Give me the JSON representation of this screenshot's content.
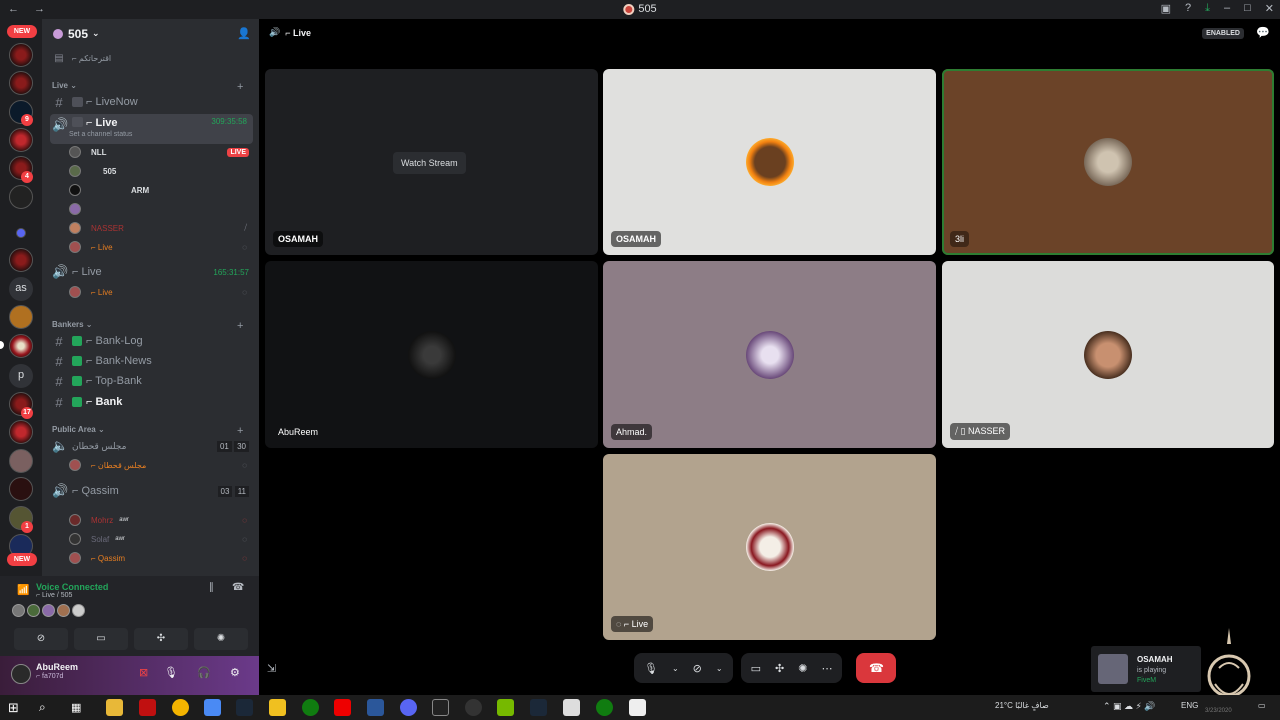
{
  "window": {
    "title": "505",
    "nav": "← →"
  },
  "server_rail": {
    "new_label": "NEW",
    "text_servers": [
      "as",
      "p"
    ],
    "badges": [
      "9",
      "4",
      "17",
      "1"
    ]
  },
  "guild": {
    "name": "505",
    "top_channel": "⌐ اقترحاتكم",
    "categories": [
      {
        "name": "Live"
      },
      {
        "name": "Bankers"
      },
      {
        "name": "Public Area"
      }
    ],
    "live_channels": {
      "livenow": "⌐ LiveNow",
      "live1": {
        "name": "⌐ Live",
        "status": "Set a channel status",
        "timer": "309:35:58"
      },
      "live2": {
        "name": "⌐ Live",
        "timer": "165:31:57"
      }
    },
    "live1_users": [
      {
        "name": "",
        "tag": "NLL",
        "live": "LIVE"
      },
      {
        "name": "",
        "tag": "505"
      },
      {
        "name": "",
        "tag": "ARM"
      },
      {
        "name": "",
        "tag": ""
      },
      {
        "name": "NASSER",
        "tag": ""
      },
      {
        "name": "",
        "tag": "⌐ Live"
      }
    ],
    "live2_users": [
      {
        "name": "⌐ Live"
      }
    ],
    "bank_channels": [
      "⌐ Bank-Log",
      "⌐ Bank-News",
      "⌐ Top-Bank",
      "⌐ Bank"
    ],
    "public": {
      "ch1": {
        "name": "مجلس قحطان",
        "count_a": "01",
        "count_b": "30"
      },
      "ch1_user": "⌐ مجلس قحطان",
      "ch2": {
        "name": "⌐ Qassim",
        "count_a": "03",
        "count_b": "11"
      },
      "ch2_users": [
        {
          "name": "Mohrz",
          "tag": "awr"
        },
        {
          "name": "Solaf",
          "tag": "awr"
        },
        {
          "name": "⌐ Qassim",
          "tag": ""
        }
      ]
    }
  },
  "voice_panel": {
    "title": "Voice Connected",
    "sub": "⌐ Live / 505"
  },
  "user_bar": {
    "name": "AbuReem",
    "tag": "⌐ fa707d"
  },
  "stage": {
    "channel": "⌐ Live",
    "enabled": "ENABLED",
    "watch_label": "Watch Stream",
    "tiles": [
      {
        "label": "OSAMAH",
        "kind": "stream"
      },
      {
        "label": "OSAMAH",
        "kind": "cam"
      },
      {
        "label": "3li",
        "kind": "cam"
      },
      {
        "label": "AbuReem",
        "kind": "cam"
      },
      {
        "label": "Ahmad.",
        "kind": "cam"
      },
      {
        "label": "NASSER",
        "kind": "cam"
      },
      {
        "label": "⌐ Live",
        "kind": "cam"
      }
    ]
  },
  "notification": {
    "name": "OSAMAH",
    "line": "is playing",
    "game": "FiveM"
  },
  "taskbar": {
    "weather": "21°C  صافٍ غالبًا",
    "lang": "ENG",
    "date": "3/23/2020"
  },
  "colors": {
    "green": "#23a55a",
    "red": "#ed4245",
    "sidebar": "#2b2d31",
    "rail": "#1e1f22"
  }
}
